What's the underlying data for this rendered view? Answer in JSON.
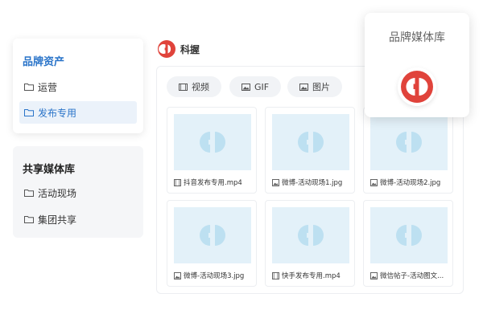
{
  "sidebar": {
    "brand_section": {
      "title": "品牌资产",
      "items": [
        {
          "label": "运营",
          "active": false
        },
        {
          "label": "发布专用",
          "active": true
        }
      ]
    },
    "shared_section": {
      "title": "共享媒体库",
      "items": [
        {
          "label": "活动现场"
        },
        {
          "label": "集团共享"
        }
      ]
    }
  },
  "header": {
    "brand_name": "科握",
    "logo_icon": "brand-logo-icon"
  },
  "filters": [
    {
      "label": "视频",
      "icon": "video-icon"
    },
    {
      "label": "GIF",
      "icon": "image-icon"
    },
    {
      "label": "图片",
      "icon": "image-icon"
    }
  ],
  "assets": [
    {
      "name": "抖音发布专用.mp4",
      "type": "video"
    },
    {
      "name": "微博-活动现场1.jpg",
      "type": "image"
    },
    {
      "name": "微博-活动现场2.jpg",
      "type": "image"
    },
    {
      "name": "微博-活动现场3.jpg",
      "type": "image"
    },
    {
      "name": "快手发布专用.mp4",
      "type": "video"
    },
    {
      "name": "微信帖子-活动图文...",
      "type": "image"
    }
  ],
  "float_card": {
    "title": "品牌媒体库"
  },
  "colors": {
    "accent_blue": "#2a74c9",
    "brand_red": "#e0433b",
    "thumb_bg": "#e3f1f9",
    "thumb_logo": "#bde0f1"
  }
}
